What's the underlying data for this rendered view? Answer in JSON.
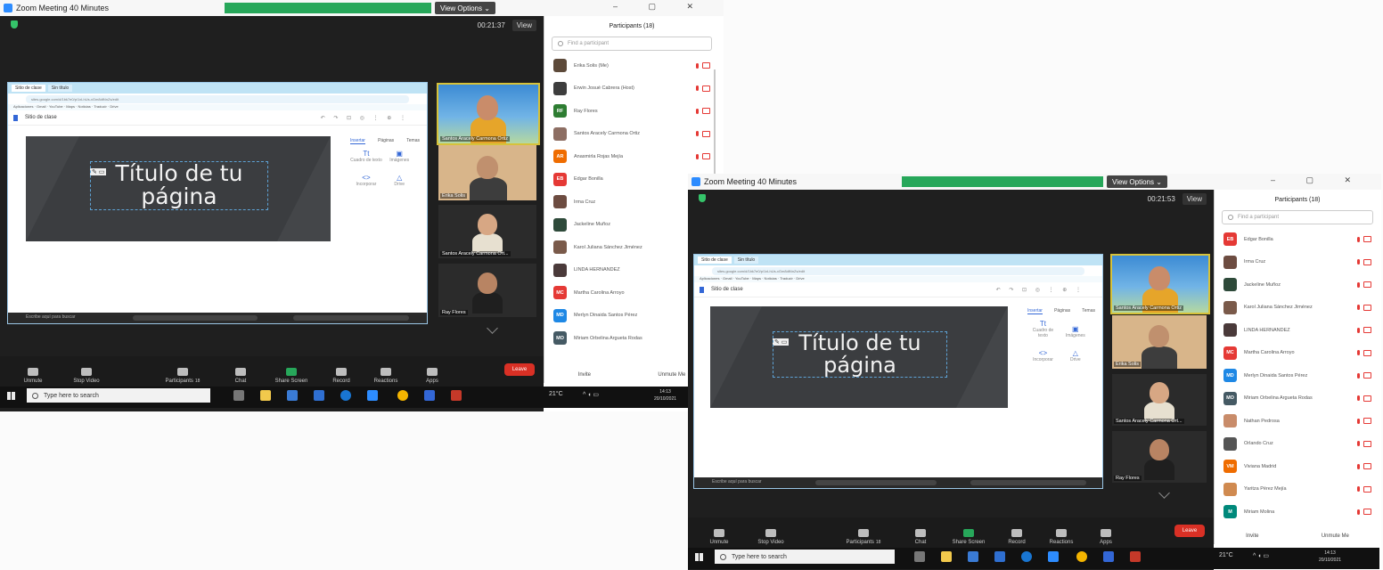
{
  "screens": [
    {
      "window_title": "Zoom Meeting 40 Minutes",
      "view_options": "View Options ⌄",
      "timer": "00:21:37",
      "view_label": "View",
      "browser": {
        "tabs": [
          "Sitio de clase",
          "Sin título"
        ],
        "address": "sites.google.com/d/1bk7e0/p/1xLhUs-xGm8dtNnZs/edit",
        "bookmarks": "Aplicaciones · Gmail · YouTube · Maps · Noticias · Traducir · Drive",
        "doc_title": "Sitio de clase",
        "tools": "↶ ↷ ⊡ ◎ ⋮ ⊕ ⋮",
        "page_title": "Título de tu página",
        "panel_tabs": [
          "Insertar",
          "Páginas",
          "Temas"
        ],
        "panel_tiles": [
          "Cuadro de texto",
          "Imágenes",
          "Incorporar",
          "Drive"
        ],
        "taskbar_search": "Escribe aquí para buscar"
      },
      "videos": [
        {
          "name": "Santos Aracely Carmona Ortiz"
        },
        {
          "name": "Erika Solis"
        },
        {
          "name": "Santos Aracely Carmona Ort..."
        },
        {
          "name": "Ray Flores"
        }
      ],
      "participants_title": "Participants (18)",
      "search_placeholder": "Find a participant",
      "participants": [
        {
          "initials": "",
          "color": "#5d4a3a",
          "name": "Erika Solis (Me)"
        },
        {
          "initials": "",
          "color": "#3d3d3d",
          "name": "Erwin Josué Cabrera (Host)"
        },
        {
          "initials": "RF",
          "color": "#2e7d32",
          "name": "Ray Flores"
        },
        {
          "initials": "",
          "color": "#8d6e63",
          "name": "Santos Aracely Carmona Ortiz"
        },
        {
          "initials": "AR",
          "color": "#ef6c00",
          "name": "Anasmirla Rojas Mejía"
        },
        {
          "initials": "EB",
          "color": "#e53935",
          "name": "Edgar Bonilla"
        },
        {
          "initials": "",
          "color": "#6d4c41",
          "name": "Irma Cruz"
        },
        {
          "initials": "",
          "color": "#2e4a3a",
          "name": "Jackeline Muñoz"
        },
        {
          "initials": "",
          "color": "#7a5a4a",
          "name": "Karol Juliana Sánchez Jiménez"
        },
        {
          "initials": "",
          "color": "#4a3a3a",
          "name": "LINDA HERNANDEZ"
        },
        {
          "initials": "MC",
          "color": "#e53935",
          "name": "Martha Carolina Arroyo"
        },
        {
          "initials": "MD",
          "color": "#1e88e5",
          "name": "Merlyn Dinaida Santos Pérez"
        },
        {
          "initials": "MO",
          "color": "#455a64",
          "name": "Miriam Orbelina Argueta Rodas"
        }
      ],
      "invite_label": "Invite",
      "unmute_me_label": "Unmute Me",
      "toolbar": {
        "unmute": "Unmute",
        "stop_video": "Stop Video",
        "participants": "Participants",
        "participant_count": "18",
        "chat": "Chat",
        "share_screen": "Share Screen",
        "record": "Record",
        "reactions": "Reactions",
        "apps": "Apps",
        "leave": "Leave"
      },
      "taskbar": {
        "search": "Type here to search",
        "weather": "21°C",
        "time": "14:13",
        "date": "20/10/2021"
      }
    },
    {
      "window_title": "Zoom Meeting 40 Minutes",
      "view_options": "View Options ⌄",
      "timer": "00:21:53",
      "view_label": "View",
      "browser": {
        "tabs": [
          "Sitio de clase",
          "Sin título"
        ],
        "address": "sites.google.com/d/1bk7e0/p/1xLhUs-xGm8dtNnZs/edit",
        "bookmarks": "Aplicaciones · Gmail · YouTube · Maps · Noticias · Traducir · Drive",
        "doc_title": "Sitio de clase",
        "tools": "↶ ↷ ⊡ ◎ ⋮ ⊕ ⋮",
        "page_title": "Título de tu página",
        "panel_tabs": [
          "Insertar",
          "Páginas",
          "Temas"
        ],
        "panel_tiles": [
          "Cuadro de texto",
          "Imágenes",
          "Incorporar",
          "Drive"
        ],
        "taskbar_search": "Escribe aquí para buscar"
      },
      "videos": [
        {
          "name": "Santos Aracely Carmona Ortiz"
        },
        {
          "name": "Erika Solis"
        },
        {
          "name": "Santos Aracely Carmona Ort..."
        },
        {
          "name": "Ray Flores"
        }
      ],
      "participants_title": "Participants (18)",
      "search_placeholder": "Find a participant",
      "participants": [
        {
          "initials": "EB",
          "color": "#e53935",
          "name": "Edgar Bonilla"
        },
        {
          "initials": "",
          "color": "#6d4c41",
          "name": "Irma Cruz"
        },
        {
          "initials": "",
          "color": "#2e4a3a",
          "name": "Jackeline Muñoz"
        },
        {
          "initials": "",
          "color": "#7a5a4a",
          "name": "Karol Juliana Sánchez Jiménez"
        },
        {
          "initials": "",
          "color": "#4a3a3a",
          "name": "LINDA HERNANDEZ"
        },
        {
          "initials": "MC",
          "color": "#e53935",
          "name": "Martha Carolina Arroyo"
        },
        {
          "initials": "MD",
          "color": "#1e88e5",
          "name": "Merlyn Dinaida Santos Pérez"
        },
        {
          "initials": "MO",
          "color": "#455a64",
          "name": "Miriam Orbelina Argueta Rodas"
        },
        {
          "initials": "",
          "color": "#c98c6a",
          "name": "Nathan Pedrosa"
        },
        {
          "initials": "",
          "color": "#555555",
          "name": "Orlando Cruz"
        },
        {
          "initials": "VM",
          "color": "#ef6c00",
          "name": "Viviana Madrid"
        },
        {
          "initials": "",
          "color": "#d08a50",
          "name": "Yaritza Pérez Mejía"
        },
        {
          "initials": "M",
          "color": "#00897b",
          "name": "Miriam Molina"
        }
      ],
      "invite_label": "Invite",
      "unmute_me_label": "Unmute Me",
      "toolbar": {
        "unmute": "Unmute",
        "stop_video": "Stop Video",
        "participants": "Participants",
        "participant_count": "18",
        "chat": "Chat",
        "share_screen": "Share Screen",
        "record": "Record",
        "reactions": "Reactions",
        "apps": "Apps",
        "leave": "Leave"
      },
      "taskbar": {
        "search": "Type here to search",
        "weather": "21°C",
        "time": "14:13",
        "date": "20/10/2021"
      }
    }
  ]
}
